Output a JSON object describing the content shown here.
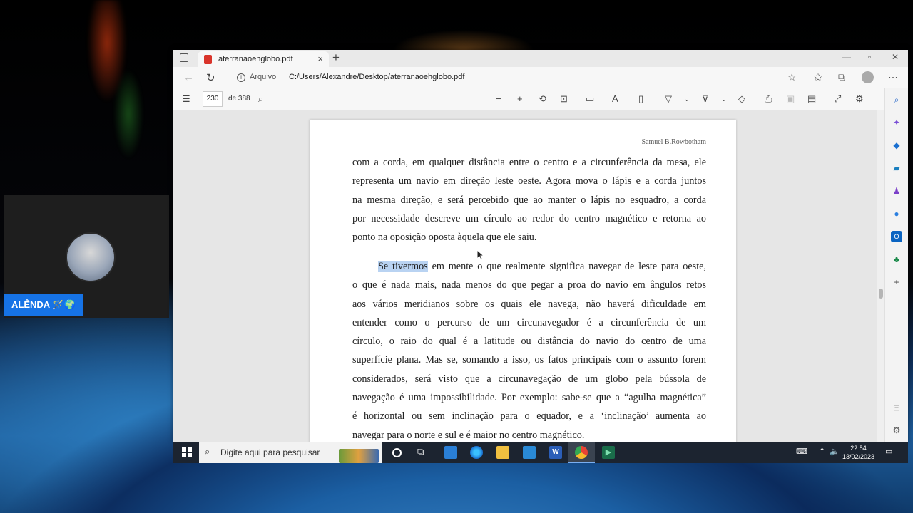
{
  "webcam": {
    "name_label": "ALÊNDA 🪄🌍"
  },
  "browser": {
    "tab": {
      "title": "aterranaoehglobo.pdf",
      "close": "×"
    },
    "new_tab": "+",
    "window_controls": {
      "minimize": "—",
      "maximize": "▫",
      "close": "✕"
    },
    "address": {
      "label": "Arquivo",
      "url": "C:/Users/Alexandre/Desktop/aterranaoehglobo.pdf"
    }
  },
  "pdf_toolbar": {
    "page_number": "230",
    "page_total": "de 388",
    "icons": [
      "contents-icon",
      "search-icon",
      "zoom-out-icon",
      "zoom-in-icon",
      "rotate-icon",
      "fit-page-icon",
      "page-view-icon",
      "read-aloud-icon",
      "immersive-reader-icon",
      "draw-icon",
      "highlight-icon",
      "eraser-icon",
      "print-icon",
      "save-icon",
      "save-as-icon",
      "fullscreen-icon",
      "settings-icon"
    ]
  },
  "document": {
    "header": "Samuel B.Rowbotham",
    "para1_lines": [
      "com a corda, em qualquer  distância entre o centro e a circunferência da mesa, ele",
      "representa um navio em direção leste oeste. Agora mova o lápis e a corda  juntos",
      "na mesma direção, e será percebido que ao manter o lápis no esquadro, a corda",
      "por necessidade descreve um círculo ao redor do centro magnético e retorna ao",
      "ponto na oposição oposta àquela que ele saiu."
    ],
    "para2_highlight": "Se tivermos",
    "para2_first_rest": " em mente o que realmente significa navegar de leste para oeste,",
    "para2_lines": [
      "o que é nada mais, nada menos do que pegar a proa do navio em ângulos retos",
      "aos vários meridianos sobre os quais ele navega, não haverá dificuldade em",
      "entender como o percurso de um circunavegador é a circunferência de um",
      "círculo, o raio do qual é a latitude ou distância do navio do centro de uma",
      "superfície plana. Mas se, somando a isso, os fatos principais com o assunto forem",
      "considerados, será visto que a circunavegação de um globo pela bússola de",
      "navegação é uma impossibilidade. Por exemplo: sabe-se que a “agulha magnética”",
      "é horizontal ou sem inclinação para o equador, e a ‘inclinação’ aumenta ao",
      "navegar para o norte e sul e é maior no centro magnético."
    ]
  },
  "taskbar": {
    "search_placeholder": "Digite aqui para pesquisar",
    "time": "22:54",
    "date": "13/02/2023"
  },
  "colors": {
    "highlight": "#b9d3f2",
    "taskbar": "#1c2430",
    "cam_label": "#1673e6"
  }
}
